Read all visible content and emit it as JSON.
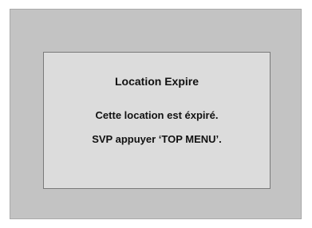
{
  "dialog": {
    "title": "Location Expire",
    "message_line_1": "Cette location est éxpiré.",
    "message_line_2": "SVP appuyer ‘TOP MENU’."
  },
  "colors": {
    "page_background": "#ffffff",
    "screen_background": "#c3c3c3",
    "dialog_background": "#dcdcdc",
    "dialog_border": "#7a7a7a",
    "text": "#111111"
  }
}
